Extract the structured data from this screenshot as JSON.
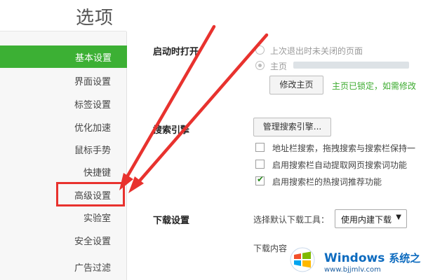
{
  "page": {
    "title": "选项"
  },
  "sidebar": {
    "items": [
      {
        "label": "基本设置",
        "active": true
      },
      {
        "label": "界面设置"
      },
      {
        "label": "标签设置"
      },
      {
        "label": "优化加速"
      },
      {
        "label": "鼠标手势"
      },
      {
        "label": "快捷键"
      },
      {
        "label": "高级设置",
        "highlighted": true
      },
      {
        "label": "实验室"
      },
      {
        "label": "安全设置"
      },
      {
        "label": "广告过滤"
      }
    ]
  },
  "startup": {
    "label": "启动时打开",
    "option_restore": "上次退出时未关闭的页面",
    "option_home": "主页",
    "home_selected": true,
    "change_home_button": "修改主页",
    "locked_note": "主页已锁定，如需修改"
  },
  "search": {
    "label": "搜索引擎",
    "manage_button": "管理搜索引擎...",
    "options": [
      {
        "label": "地址栏搜索，拖拽搜索与搜索栏保持一",
        "checked": false
      },
      {
        "label": "启用搜索栏自动提取网页搜索词功能",
        "checked": false
      },
      {
        "label": "启用搜索栏的热搜词推荐功能",
        "checked": true
      }
    ]
  },
  "download": {
    "label": "下载设置",
    "tool_label": "选择默认下载工具：",
    "tool_value": "使用内建下载",
    "content_label": "下载内容"
  },
  "watermark": {
    "title": "Windows",
    "title_cn": "系统之家",
    "url": "www.bjjmlv.com"
  },
  "colors": {
    "accent": "#3cb034",
    "annotation": "#e8322e",
    "note": "#3cab2f"
  }
}
